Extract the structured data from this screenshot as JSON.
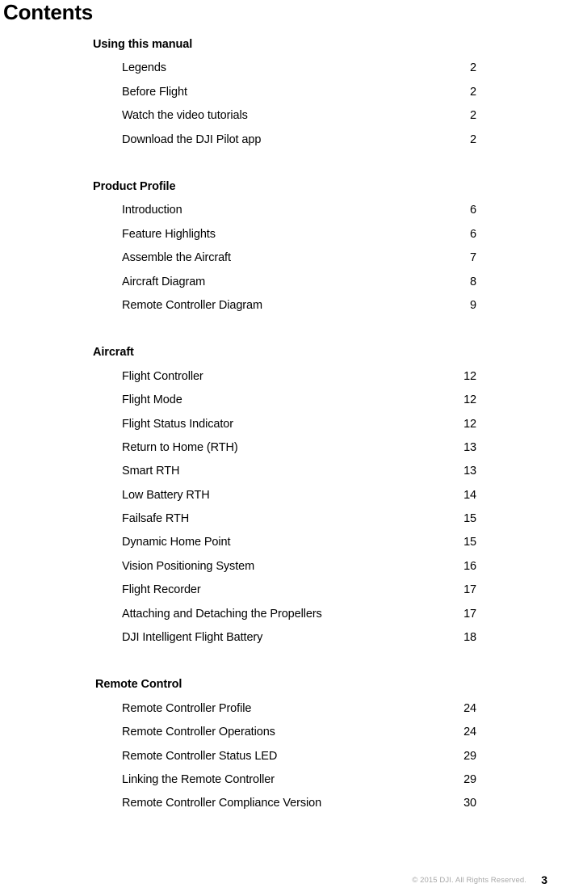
{
  "page_title": "Contents",
  "toc": {
    "sections": [
      {
        "heading": "Using this manual",
        "indented": false,
        "entries": [
          {
            "label": "Legends",
            "page": "2"
          },
          {
            "label": "Before Flight",
            "page": "2"
          },
          {
            "label": "Watch the video tutorials",
            "page": "2"
          },
          {
            "label": "Download the DJI Pilot app",
            "page": "2"
          }
        ]
      },
      {
        "heading": "Product Profile",
        "indented": false,
        "entries": [
          {
            "label": "Introduction",
            "page": "6"
          },
          {
            "label": "Feature Highlights",
            "page": "6"
          },
          {
            "label": "Assemble the Aircraft",
            "page": "7"
          },
          {
            "label": "Aircraft Diagram",
            "page": "8"
          },
          {
            "label": "Remote Controller Diagram",
            "page": "9"
          }
        ]
      },
      {
        "heading": "Aircraft",
        "indented": false,
        "entries": [
          {
            "label": "Flight Controller",
            "page": "12"
          },
          {
            "label": "Flight Mode",
            "page": "12"
          },
          {
            "label": "Flight Status Indicator",
            "page": "12"
          },
          {
            "label": "Return to Home (RTH)",
            "page": "13"
          },
          {
            "label": "Smart RTH",
            "page": "13"
          },
          {
            "label": "Low Battery RTH",
            "page": "14"
          },
          {
            "label": "Failsafe RTH",
            "page": "15"
          },
          {
            "label": "Dynamic Home Point",
            "page": "15"
          },
          {
            "label": "Vision Positioning System",
            "page": "16"
          },
          {
            "label": "Flight Recorder",
            "page": "17"
          },
          {
            "label": "Attaching and Detaching the Propellers",
            "page": "17"
          },
          {
            "label": "DJI Intelligent Flight Battery",
            "page": "18"
          }
        ]
      },
      {
        "heading": "Remote Control",
        "indented": true,
        "entries": [
          {
            "label": "Remote Controller Profile",
            "page": "24"
          },
          {
            "label": "Remote Controller Operations",
            "page": "24"
          },
          {
            "label": "Remote Controller Status LED",
            "page": "29"
          },
          {
            "label": "Linking the Remote Controller",
            "page": "29"
          },
          {
            "label": "Remote Controller Compliance Version",
            "page": "30"
          }
        ]
      }
    ]
  },
  "footer": {
    "copyright": "© 2015 DJI. All Rights Reserved.",
    "page_number": "3"
  },
  "colors": {
    "text": "#000000",
    "footer_text": "#a8a8a8",
    "background": "#ffffff"
  }
}
